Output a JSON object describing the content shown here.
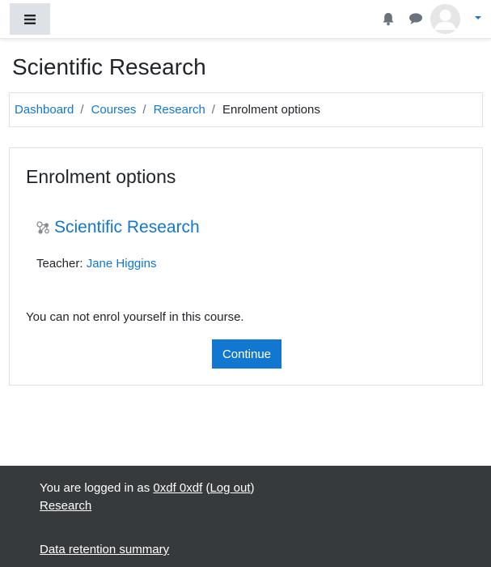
{
  "navbar": {
    "menu_icon": "hamburger-icon",
    "notifications_icon": "bell-icon",
    "messages_icon": "chat-bubble-icon",
    "user_avatar": "default-user-avatar",
    "user_menu_icon": "caret-down-icon"
  },
  "page": {
    "title": "Scientific Research"
  },
  "breadcrumb": {
    "items": [
      {
        "label": "Dashboard"
      },
      {
        "label": "Courses"
      },
      {
        "label": "Research"
      }
    ],
    "separator": "/",
    "current": "Enrolment options"
  },
  "enrolment": {
    "heading": "Enrolment options",
    "course_icon": "course-molecule-icon",
    "course_name": "Scientific Research",
    "teacher_label": "Teacher:",
    "teacher_name": "Jane Higgins",
    "notice": "You can not enrol yourself in this course.",
    "continue_label": "Continue"
  },
  "footer": {
    "logged_in_prefix": "You are logged in as",
    "user_name": "0xdf 0xdf",
    "open_paren": "(",
    "logout_label": "Log out",
    "close_paren": ")",
    "course_link": "Research",
    "data_retention_link": "Data retention summary"
  },
  "colors": {
    "link": "#1177d1",
    "primary_button": "#1177d1",
    "footer_bg": "#373a3c",
    "menu_button_bg": "#dee2e6"
  }
}
